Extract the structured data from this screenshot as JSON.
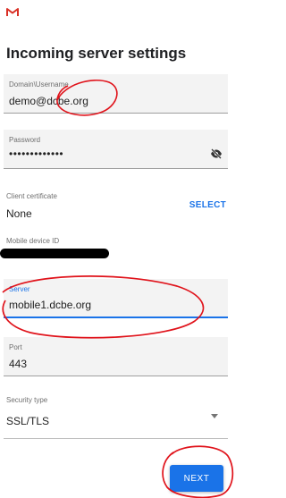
{
  "title": "Incoming server settings",
  "fields": {
    "domain_username": {
      "label": "Domain\\Username",
      "value": "demo@dcbe.org"
    },
    "password": {
      "label": "Password",
      "value": "•••••••••••••"
    },
    "server": {
      "label": "Server",
      "value": "mobile1.dcbe.org"
    },
    "port": {
      "label": "Port",
      "value": "443"
    }
  },
  "client_certificate": {
    "label": "Client certificate",
    "value": "None",
    "action": "SELECT"
  },
  "mobile_device_id": {
    "label": "Mobile device ID"
  },
  "security_type": {
    "label": "Security type",
    "value": "SSL/TLS"
  },
  "next_button": "NEXT",
  "colors": {
    "accent": "#1a73e8",
    "gmail_red": "#d93025",
    "annotation_red": "#e0131b",
    "field_bg": "#f3f3f3"
  },
  "icons": [
    "gmail-logo",
    "visibility-off-icon",
    "dropdown-arrow-icon"
  ]
}
